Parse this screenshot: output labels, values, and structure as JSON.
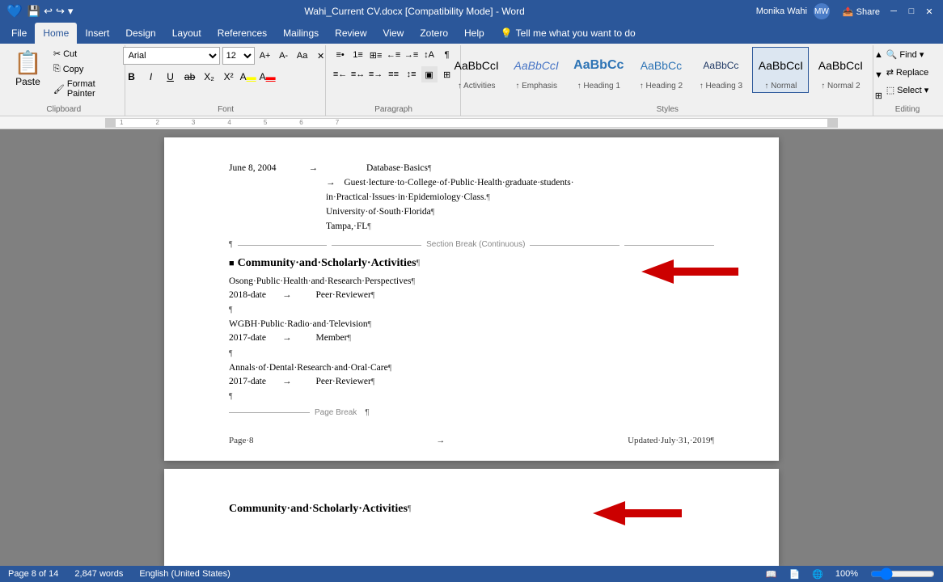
{
  "titlebar": {
    "quickaccess": [
      "save",
      "undo",
      "redo",
      "customize"
    ],
    "title": "Wahi_Current CV.docx [Compatibility Mode] - Word",
    "user": "Monika Wahi",
    "controls": [
      "minimize",
      "restore",
      "close"
    ]
  },
  "tabs": [
    {
      "id": "file",
      "label": "File"
    },
    {
      "id": "home",
      "label": "Home",
      "active": true
    },
    {
      "id": "insert",
      "label": "Insert"
    },
    {
      "id": "design",
      "label": "Design"
    },
    {
      "id": "layout",
      "label": "Layout"
    },
    {
      "id": "references",
      "label": "References"
    },
    {
      "id": "mailings",
      "label": "Mailings"
    },
    {
      "id": "review",
      "label": "Review"
    },
    {
      "id": "view",
      "label": "View"
    },
    {
      "id": "zotero",
      "label": "Zotero"
    },
    {
      "id": "help",
      "label": "Help"
    },
    {
      "id": "search",
      "label": "Tell me what you want to do"
    }
  ],
  "ribbon": {
    "clipboard": {
      "label": "Clipboard",
      "paste": "Paste",
      "cut": "Cut",
      "copy": "Copy",
      "format_painter": "Format Painter"
    },
    "font": {
      "label": "Font",
      "family": "Arial",
      "size": "12",
      "grow": "A",
      "shrink": "A",
      "case": "Aa",
      "clear": "✕",
      "bold": "B",
      "italic": "I",
      "underline": "U",
      "strikethrough": "ab",
      "subscript": "X₂",
      "superscript": "X²",
      "highlight": "A",
      "color": "A"
    },
    "paragraph": {
      "label": "Paragraph"
    },
    "styles": {
      "label": "Styles",
      "items": [
        {
          "id": "activities",
          "label": "↑ Activities",
          "preview": "AaBbCcI",
          "active": false
        },
        {
          "id": "emphasis",
          "label": "↑ Emphasis",
          "preview": "AaBbCcI",
          "active": false,
          "italic": true
        },
        {
          "id": "heading1",
          "label": "↑ Heading 1",
          "preview": "AaBbCc",
          "active": false
        },
        {
          "id": "heading2",
          "label": "↑ Heading 2",
          "preview": "AaBbCc",
          "active": false
        },
        {
          "id": "heading3",
          "label": "↑ Heading 3",
          "preview": "AaBbCc",
          "active": false
        },
        {
          "id": "normal",
          "label": "↑ Normal",
          "preview": "AaBbCcI",
          "active": true
        },
        {
          "id": "normal2",
          "label": "↑ Normal 2",
          "preview": "AaBbCcI",
          "active": false
        }
      ]
    },
    "editing": {
      "label": "Editing",
      "find": "Find",
      "replace": "Replace",
      "select": "Select ▼"
    }
  },
  "document": {
    "page8": {
      "lines": [
        {
          "text": "June 8, 2004",
          "indent": 0,
          "type": "date"
        },
        {
          "text": "→",
          "indent": 1,
          "type": "arrow"
        },
        {
          "text": "Database Basics¶",
          "indent": 2,
          "type": "content"
        },
        {
          "text": "Guest·lecture·to·College·of·Public·Health·graduate·students·",
          "indent": 2,
          "type": "content"
        },
        {
          "text": "in·Practical·Issues·in·Epidemiology·Class.¶",
          "indent": 2,
          "type": "content"
        },
        {
          "text": "University·of·South·Florida¶",
          "indent": 2,
          "type": "content"
        },
        {
          "text": "Tampa,·FL¶",
          "indent": 2,
          "type": "content"
        }
      ],
      "section_break": "Section Break (Continuous)",
      "heading": "Community·and·Scholarly·Activities¶",
      "body_lines": [
        {
          "org": "Osong·Public·Health·and·Research·Perspectives¶",
          "date": "2018-date",
          "role": "Peer·Reviewer¶"
        },
        {
          "org": "WGBH·Public·Radio·and·Television¶",
          "date": "2017-date",
          "role": "Member¶"
        },
        {
          "org": "Annals·of·Dental·Research·and·Oral·Care¶",
          "date": "2017-date",
          "role": "Peer·Reviewer¶"
        }
      ],
      "page_break_label": "Page Break",
      "footer": {
        "left": "Page·8",
        "right": "Updated·July·31,·2019¶"
      }
    },
    "page9": {
      "heading": "Community·and·Scholarly·Activities¶"
    }
  },
  "statusbar": {
    "page_info": "Page 8 of 14",
    "words": "2,847 words",
    "language": "English (United States)",
    "view_icons": [
      "read",
      "layout",
      "web"
    ],
    "zoom": "100%"
  }
}
